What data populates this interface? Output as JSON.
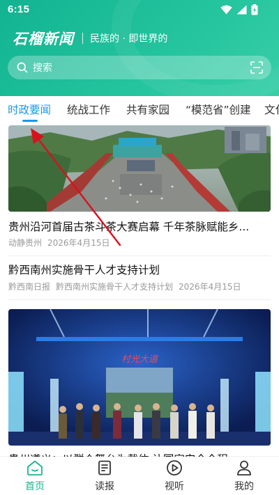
{
  "status_bar": {
    "time": "6:15"
  },
  "header": {
    "logo": "石榴新闻",
    "slogan": "民族的 · 即世界的",
    "search": {
      "placeholder": "搜索"
    }
  },
  "tabs": [
    {
      "label": "时政要闻",
      "active": true
    },
    {
      "label": "统战工作"
    },
    {
      "label": "共有家园"
    },
    {
      "label": "“模范省”创建"
    },
    {
      "label": "文化"
    }
  ],
  "news": [
    {
      "title": "贵州沿河首届古茶斗茶大赛启幕 千年茶脉赋能乡...",
      "source": "动静贵州",
      "date": "2026年4月15日",
      "image": "aerial-festival-photo"
    },
    {
      "title": "黔西南州实施骨干人才支持计划",
      "source": "黔西南日报",
      "extra": "黔西南州实施骨干人才支持计划",
      "date": "2026年4月15日"
    },
    {
      "title": "贵州遵义：以群众舞台为载体 让国家安全全程...",
      "image": "stage-performance-photo",
      "stage_sign": "村光大道"
    }
  ],
  "bottom_nav": [
    {
      "label": "首页",
      "icon": "home-icon",
      "active": true
    },
    {
      "label": "读报",
      "icon": "newspaper-icon"
    },
    {
      "label": "视听",
      "icon": "play-circle-icon"
    },
    {
      "label": "我的",
      "icon": "profile-icon"
    }
  ],
  "colors": {
    "brand_green": "#19b591",
    "tab_active_blue": "#1a9be6",
    "annotation_arrow": "#d6121e"
  }
}
